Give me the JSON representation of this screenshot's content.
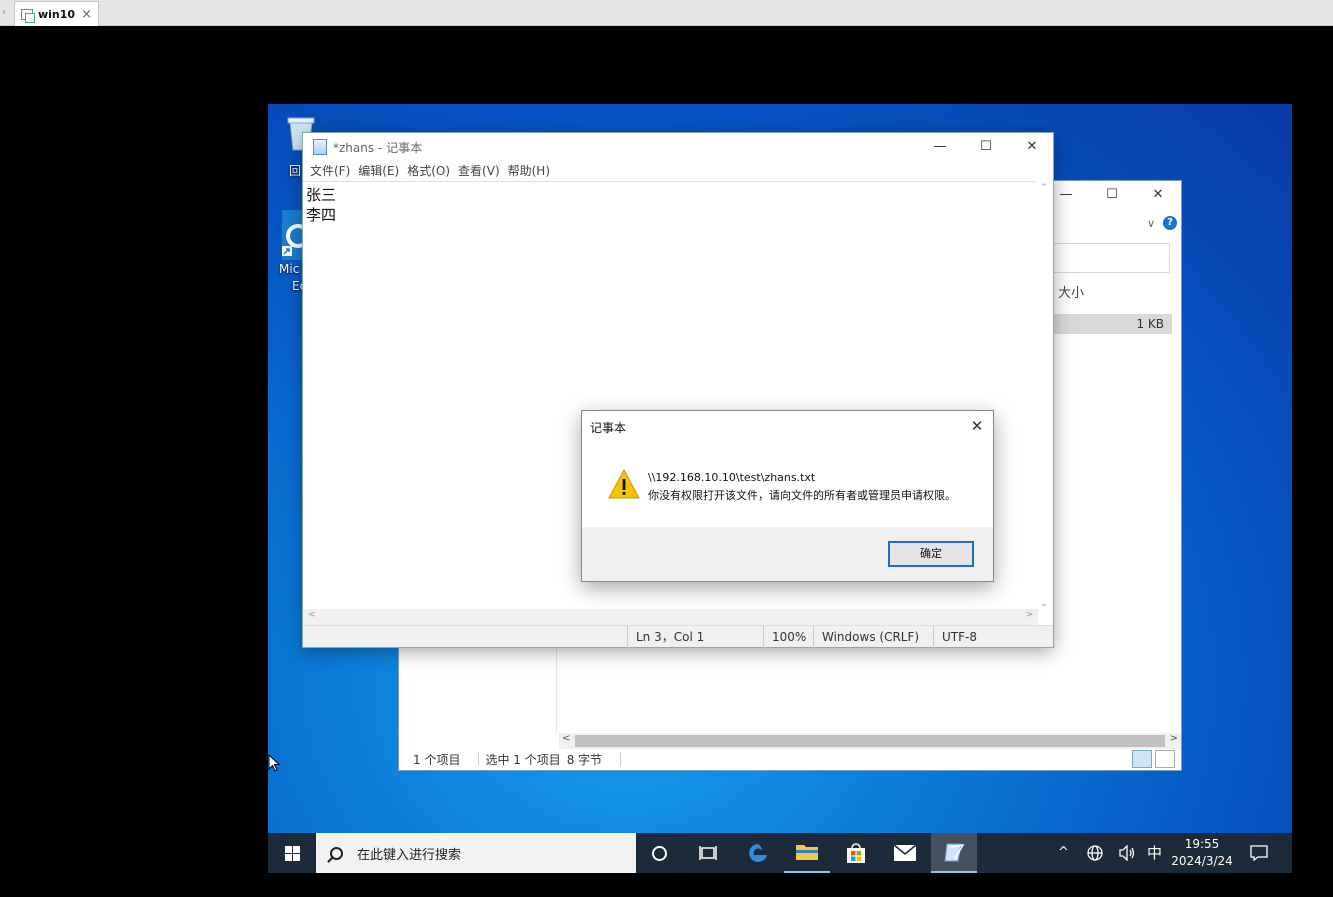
{
  "host": {
    "tab_title": "win10",
    "tab_close": "×",
    "nav": "‹"
  },
  "desktop": {
    "recycle_label": "回",
    "edge_label_1": "Mic",
    "edge_label_2": "Ec"
  },
  "explorer": {
    "minimize": "—",
    "maximize": "☐",
    "close": "✕",
    "ribbon_chevron": "∨",
    "help": "?",
    "column_size": "大小",
    "row_size": "1 KB",
    "status_items": "1 个项目",
    "status_selected": "选中 1 个项目",
    "status_bytes": "8 字节"
  },
  "notepad": {
    "title": "*zhans - 记事本",
    "minimize": "—",
    "maximize": "☐",
    "close": "✕",
    "menu": [
      "文件(F)",
      "编辑(E)",
      "格式(O)",
      "查看(V)",
      "帮助(H)"
    ],
    "lines": [
      "张三",
      "李四"
    ],
    "status": {
      "position": "Ln 3，Col 1",
      "zoom": "100%",
      "eol": "Windows (CRLF)",
      "encoding": "UTF-8"
    }
  },
  "dialog": {
    "title": "记事本",
    "close": "✕",
    "path": "\\\\192.168.10.10\\test\\zhans.txt",
    "message": "你没有权限打开该文件，请向文件的所有者或管理员申请权限。",
    "ok": "确定"
  },
  "taskbar": {
    "search_placeholder": "在此键入进行搜索",
    "tray_chevron": "^",
    "ime": "中",
    "time": "19:55",
    "date": "2024/3/24"
  },
  "colors": {
    "accent": "#1a6fc4",
    "taskbar": "#1c2a3a",
    "warning": "#f5c400"
  }
}
